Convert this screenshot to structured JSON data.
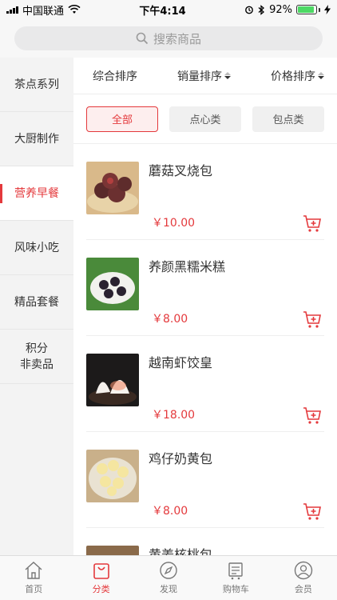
{
  "status_bar": {
    "carrier": "中国联通",
    "time": "下午4:14",
    "battery": "92%",
    "battery_level": 0.92
  },
  "search": {
    "placeholder": "搜索商品"
  },
  "sidebar": {
    "items": [
      {
        "label": "茶点系列",
        "active": false
      },
      {
        "label": "大厨制作",
        "active": false
      },
      {
        "label": "营养早餐",
        "active": true
      },
      {
        "label": "风味小吃",
        "active": false
      },
      {
        "label": "精品套餐",
        "active": false
      },
      {
        "label": "积分\n非卖品",
        "active": false
      }
    ]
  },
  "sort": {
    "composite": "综合排序",
    "sales": "销量排序",
    "price": "价格排序"
  },
  "filters": [
    {
      "label": "全部",
      "active": true
    },
    {
      "label": "点心类",
      "active": false
    },
    {
      "label": "包点类",
      "active": false
    }
  ],
  "products": [
    {
      "name": "蘑菇叉烧包",
      "price": "￥10.00"
    },
    {
      "name": "养颜黑糯米糕",
      "price": "￥8.00"
    },
    {
      "name": "越南虾饺皇",
      "price": "￥18.00"
    },
    {
      "name": "鸡仔奶黄包",
      "price": "￥8.00"
    },
    {
      "name": "黄姜核桃包",
      "price": ""
    }
  ],
  "tabbar": [
    {
      "label": "首页",
      "icon": "home-icon",
      "active": false
    },
    {
      "label": "分类",
      "icon": "category-bag-icon",
      "active": true
    },
    {
      "label": "发现",
      "icon": "compass-icon",
      "active": false
    },
    {
      "label": "购物车",
      "icon": "cart-icon",
      "active": false
    },
    {
      "label": "会员",
      "icon": "user-icon",
      "active": false
    }
  ],
  "colors": {
    "accent": "#e4393c",
    "sidebar_bg": "#f3f3f3"
  }
}
